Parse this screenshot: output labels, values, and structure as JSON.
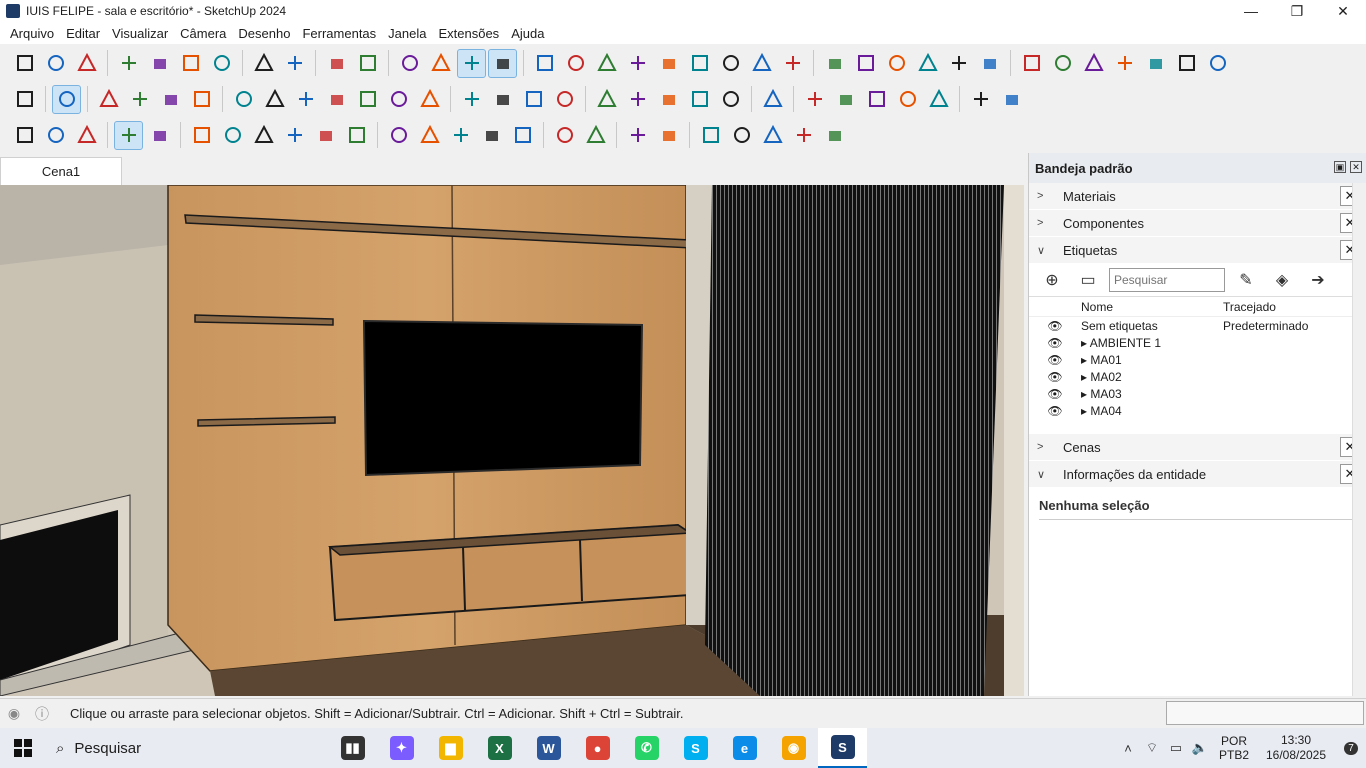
{
  "window": {
    "title": "IUIS FELIPE - sala e escritório* - SketchUp 2024",
    "controls": {
      "minimize": "—",
      "maximize": "❐",
      "close": "✕"
    }
  },
  "menu": [
    "Arquivo",
    "Editar",
    "Visualizar",
    "Câmera",
    "Desenho",
    "Ferramentas",
    "Janela",
    "Extensões",
    "Ajuda"
  ],
  "toolbars": {
    "row1": [
      "new-file",
      "open-folder",
      "save",
      "cut",
      "copy",
      "paste",
      "erase",
      "undo",
      "redo",
      "print",
      "model-info",
      "orbit-view",
      "iso-view",
      "top-view",
      "front-view",
      "orbit",
      "pan",
      "zoom",
      "zoom-window",
      "zoom-extents",
      "previous-view",
      "position-camera",
      "look-around",
      "walk",
      "section-plane",
      "dimension",
      "protractor",
      "text",
      "axes",
      "3d-text",
      "warehouse",
      "component",
      "home",
      "door",
      "window-shape",
      "wall",
      "wall-2"
    ],
    "row2": [
      "search",
      "select",
      "eraser",
      "pencil",
      "line",
      "rectangle",
      "push-pull",
      "follow-me",
      "move",
      "rotate",
      "scale",
      "offset",
      "tape-measure",
      "paint-bucket",
      "orbit",
      "pan",
      "zoom",
      "zoom-extents",
      "layers",
      "stack",
      "stack-2",
      "stack-3",
      "user",
      "folder-2015",
      "folder-2016",
      "floppy",
      "floppy-red",
      "bucket",
      "new-doc",
      "add-user"
    ],
    "row3": [
      "shelf-tool",
      "list",
      "panel-split",
      "sofa",
      "bricks",
      "cube-color",
      "sun",
      "dollar-box",
      "play",
      "people",
      "bubble",
      "align-left",
      "group-select",
      "wire",
      "plug",
      "diamond",
      "arrows-left",
      "arrows-right",
      "note",
      "chat",
      "g-logo",
      "cloud",
      "bag",
      "dollar",
      "doc"
    ]
  },
  "scene_tab": "Cena1",
  "tray": {
    "title": "Bandeja padrão",
    "panels": {
      "materials": "Materiais",
      "components": "Componentes",
      "tags": "Etiquetas",
      "scenes": "Cenas",
      "entity_info": "Informações da entidade"
    },
    "tags": {
      "search_placeholder": "Pesquisar",
      "headers": {
        "name": "Nome",
        "dash": "Tracejado"
      },
      "rows": [
        {
          "name": "Sem etiquetas",
          "dash": "Predeterminado",
          "expandable": false
        },
        {
          "name": "AMBIENTE 1",
          "dash": "",
          "expandable": true
        },
        {
          "name": "MA01",
          "dash": "",
          "expandable": true
        },
        {
          "name": "MA02",
          "dash": "",
          "expandable": true
        },
        {
          "name": "MA03",
          "dash": "",
          "expandable": true
        },
        {
          "name": "MA04",
          "dash": "",
          "expandable": true
        }
      ]
    },
    "entity_info_text": "Nenhuma seleção"
  },
  "status": {
    "text": "Clique ou arraste para selecionar objetos. Shift = Adicionar/Subtrair. Ctrl = Adicionar. Shift + Ctrl = Subtrair."
  },
  "taskbar": {
    "search": "Pesquisar",
    "apps": [
      {
        "name": "task-view",
        "label": "▮▮",
        "color": "#333333"
      },
      {
        "name": "copilot",
        "label": "✦",
        "color": "#7b5cff"
      },
      {
        "name": "file-explorer",
        "label": "▆",
        "color": "#f2b600"
      },
      {
        "name": "excel",
        "label": "X",
        "color": "#1d7044"
      },
      {
        "name": "word",
        "label": "W",
        "color": "#2b579a"
      },
      {
        "name": "chrome",
        "label": "●",
        "color": "#db4437"
      },
      {
        "name": "whatsapp",
        "label": "✆",
        "color": "#25d366"
      },
      {
        "name": "skype",
        "label": "S",
        "color": "#00aff0"
      },
      {
        "name": "edge",
        "label": "e",
        "color": "#0c8ce9"
      },
      {
        "name": "vpn",
        "label": "◉",
        "color": "#f4a300"
      },
      {
        "name": "sketchup",
        "label": "S",
        "color": "#1e3a66"
      }
    ],
    "lang": "POR",
    "layout": "PTB2",
    "time": "13:30",
    "date": "16/08/2025",
    "notifications": "7"
  }
}
